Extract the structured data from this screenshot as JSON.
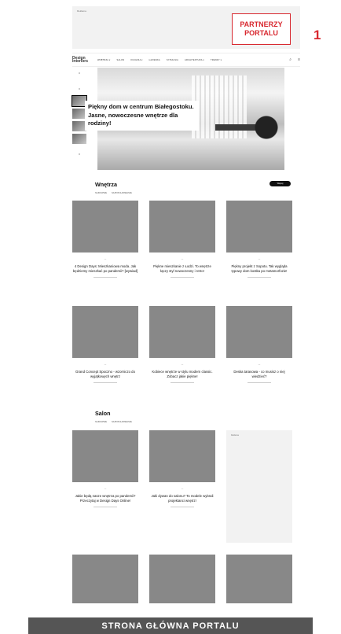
{
  "ad": {
    "label": "Reklama"
  },
  "partner": {
    "label": "PARTNERZY PORTALU",
    "number": "1"
  },
  "nav": {
    "logo": "Design Interiors",
    "items": [
      "WNĘTRZA ▾",
      "SALON",
      "KUCHNIA ▾",
      "ŁAZIENKA",
      "SYPIALNIA",
      "ARCHITEKTURA ▾",
      "TRENDY ▾"
    ]
  },
  "hero": {
    "caption": "Piękny dom w centrum Białegostoku. Jasne, nowoczesne wnętrze dla rodziny!"
  },
  "sections": {
    "wnetrza": {
      "title": "Wnętrza",
      "subnav": [
        "NAJNOWSZE",
        "NAJPOPULARNIEJSZE"
      ],
      "more": "Więcej"
    },
    "salon": {
      "title": "Salon",
      "subnav": [
        "NAJNOWSZE",
        "NAJPOPULARNIEJSZE"
      ]
    }
  },
  "cards": [
    {
      "title": "4 Design Days: Mieszkaniowa moda. Jak będziemy mieszkać po pandemii? [wywiad]"
    },
    {
      "title": "Piękne mieszkanie z Łodzi. To wnętrze łączy styl nowoczesny i retro!"
    },
    {
      "title": "Piękny projekt z Sopotu. Tak wygląda typowy dom kostka po metamorfozie!"
    },
    {
      "title": "Grand Concept Spoczno - wzorniczo do wyjątkowych wnętrz"
    },
    {
      "title": "Kobiece wnętrze w stylu modern classic. Zobacz jakie piękne!"
    },
    {
      "title": "Deska tarasowa - co musisz o niej wiedzieć?"
    },
    {
      "title": "Jakie będą nasze wnętrza po pandemii? Przeczytaj w Design Days Online!"
    },
    {
      "title": "Jaki dywan do salonu? To modele wybrali projektanci wnętrz!"
    }
  ],
  "footer_bar": {
    "label": "STRONA GŁÓWNA PORTALU"
  }
}
